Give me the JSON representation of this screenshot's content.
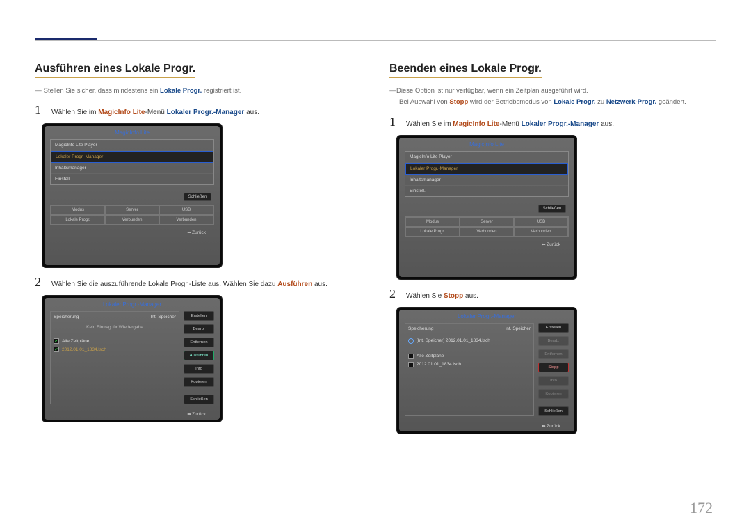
{
  "page_number": "172",
  "left": {
    "heading": "Ausführen eines Lokale Progr.",
    "note1_pre": "Stellen Sie sicher, dass mindestens ein ",
    "note1_term": "Lokale Progr.",
    "note1_post": " registriert ist.",
    "step1_a": "Wählen Sie im ",
    "step1_b": "MagicInfo Lite",
    "step1_c": "-Menü ",
    "step1_d": "Lokaler Progr.-Manager",
    "step1_e": " aus.",
    "shot1": {
      "title": "MagicInfo Lite",
      "items": [
        "MagicInfo Lite Player",
        "Lokaler Progr.-Manager",
        "Inhaltsmanager",
        "Einstell."
      ],
      "close": "Schließen",
      "grid": [
        "Modus",
        "Server",
        "USB",
        "Lokale Progr.",
        "Verbunden",
        "Verbunden"
      ],
      "back": "Zurück"
    },
    "step2_a": "Wählen Sie die auszuführende Lokale Progr.-Liste aus. Wählen Sie dazu ",
    "step2_b": "Ausführen",
    "step2_c": " aus.",
    "shot2": {
      "title": "Lokaler Progr.-Manager",
      "storage_l": "Speicherung",
      "storage_r": "Int. Speicher",
      "nodata": "Kein Eintrag für Wiedergabe",
      "row_all": "Alle Zeitpläne",
      "row_sched": "2012.01.01_1834.lsch",
      "buttons": [
        "Erstellen",
        "Bearb.",
        "Entfernen",
        "Ausführen",
        "Info",
        "Kopieren",
        "Schließen"
      ],
      "back": "Zurück"
    }
  },
  "right": {
    "heading": "Beenden eines Lokale Progr.",
    "note1": "Diese Option ist nur verfügbar, wenn ein Zeitplan ausgeführt wird.",
    "note2_a": "Bei Auswahl von ",
    "note2_b": "Stopp",
    "note2_c": " wird der Betriebsmodus von ",
    "note2_d": "Lokale Progr.",
    "note2_e": " zu ",
    "note2_f": "Netzwerk-Progr.",
    "note2_g": " geändert.",
    "step1_a": "Wählen Sie im ",
    "step1_b": "MagicInfo Lite",
    "step1_c": "-Menü ",
    "step1_d": "Lokaler Progr.-Manager",
    "step1_e": " aus.",
    "shot1": {
      "title": "MagicInfo Lite",
      "items": [
        "MagicInfo Lite Player",
        "Lokaler Progr.-Manager",
        "Inhaltsmanager",
        "Einstell."
      ],
      "close": "Schließen",
      "grid": [
        "Modus",
        "Server",
        "USB",
        "Lokale Progr.",
        "Verbunden",
        "Verbunden"
      ],
      "back": "Zurück"
    },
    "step2_a": "Wählen Sie ",
    "step2_b": "Stopp",
    "step2_c": " aus.",
    "shot2": {
      "title": "Lokaler Progr.-Manager",
      "storage_l": "Speicherung",
      "storage_r": "Int. Speicher",
      "running": "[Int. Speicher] 2012.01.01_1834.lsch",
      "row_all": "Alle Zeitpläne",
      "row_sched": "2012.01.01_1834.lsch",
      "buttons": [
        "Erstellen",
        "Bearb.",
        "Entfernen",
        "Stopp",
        "Info",
        "Kopieren",
        "Schließen"
      ],
      "back": "Zurück"
    }
  }
}
